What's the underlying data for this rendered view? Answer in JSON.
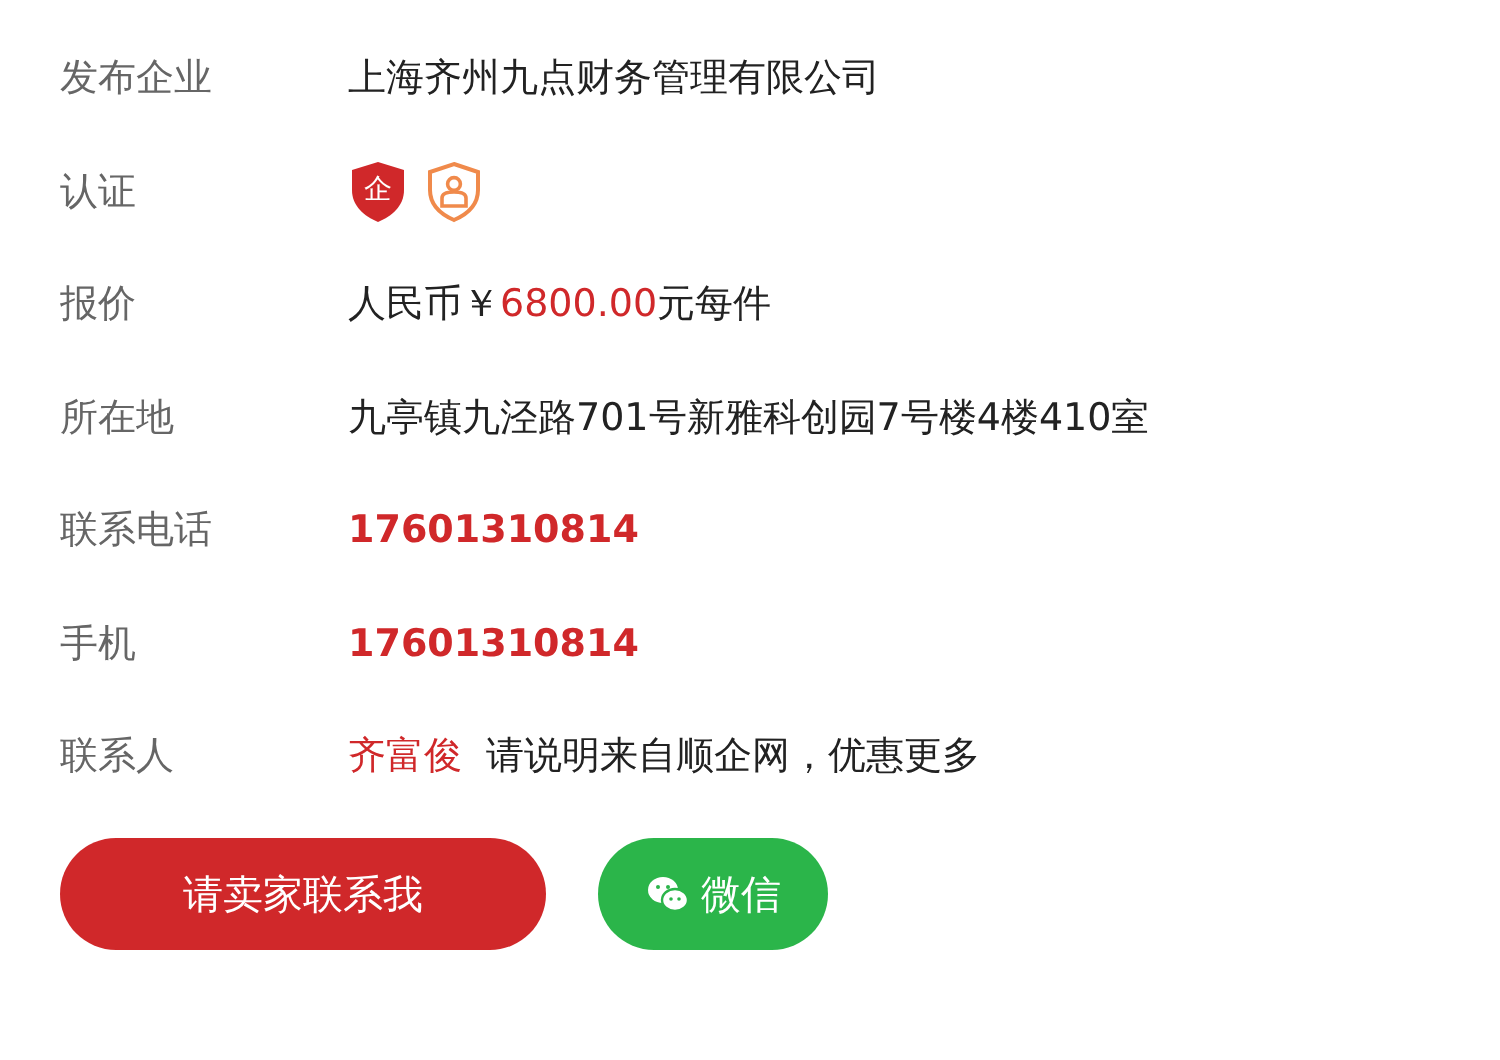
{
  "rows": [
    {
      "kind": "text",
      "label": "发布企业",
      "value": "上海齐州九点财务管理有限公司"
    },
    {
      "kind": "badges",
      "label": "认证",
      "badge_text": "企"
    },
    {
      "kind": "price",
      "label": "报价",
      "prefix": "人民币￥",
      "amount": "6800.00",
      "suffix": "元每件"
    },
    {
      "kind": "text",
      "label": "所在地",
      "value": "九亭镇九泾路701号新雅科创园7号楼4楼410室"
    },
    {
      "kind": "phone",
      "label": "联系电话",
      "value": "17601310814"
    },
    {
      "kind": "phone",
      "label": "手机",
      "value": "17601310814"
    },
    {
      "kind": "contact",
      "label": "联系人",
      "name": "齐富俊",
      "note": "请说明来自顺企网，优惠更多"
    }
  ],
  "buttons": [
    {
      "kind": "contact",
      "label": "请卖家联系我"
    },
    {
      "kind": "wechat",
      "label": "微信"
    }
  ]
}
